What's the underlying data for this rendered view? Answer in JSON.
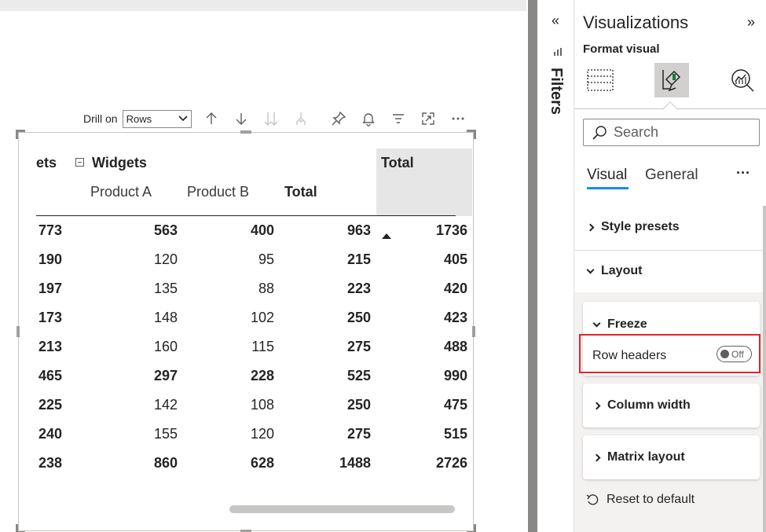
{
  "toolbar": {
    "drill_label": "Drill on",
    "drill_value": "Rows",
    "icons": [
      "drill-up-icon",
      "drill-down-icon",
      "expand-next-level-icon",
      "expand-all-icon",
      "pin-icon",
      "alert-bell-icon",
      "filter-icon",
      "focus-mode-icon",
      "more-options-icon"
    ]
  },
  "matrix": {
    "partial_header": "ets",
    "group_header": "Widgets",
    "total_header": "Total",
    "sub_headers": [
      "Product A",
      "Product B",
      "Total"
    ],
    "rows": [
      [
        "773",
        "563",
        "400",
        "963",
        "1736"
      ],
      [
        "190",
        "120",
        "95",
        "215",
        "405"
      ],
      [
        "197",
        "135",
        "88",
        "223",
        "420"
      ],
      [
        "173",
        "148",
        "102",
        "250",
        "423"
      ],
      [
        "213",
        "160",
        "115",
        "275",
        "488"
      ],
      [
        "465",
        "297",
        "228",
        "525",
        "990"
      ],
      [
        "225",
        "142",
        "108",
        "250",
        "475"
      ],
      [
        "240",
        "155",
        "120",
        "275",
        "515"
      ],
      [
        "238",
        "860",
        "628",
        "1488",
        "2726"
      ]
    ],
    "bold_rows": [
      0,
      5,
      8
    ]
  },
  "filters": {
    "label": "Filters",
    "collapse_glyph": "«"
  },
  "viz": {
    "title": "Visualizations",
    "expand_glyph": "»",
    "format_visual": "Format visual",
    "search_placeholder": "Search",
    "tabs": [
      "Visual",
      "General"
    ],
    "tabs_more": "···",
    "sections": {
      "style_presets": "Style presets",
      "layout": "Layout",
      "freeze": "Freeze",
      "row_headers": "Row headers",
      "toggle_state": "Off",
      "column_width": "Column width",
      "matrix_layout": "Matrix layout",
      "reset": "Reset to default"
    }
  },
  "colors": {
    "accent": "#118dff",
    "highlight_border": "#d9262a",
    "pane_bg": "#f3f2f1"
  }
}
